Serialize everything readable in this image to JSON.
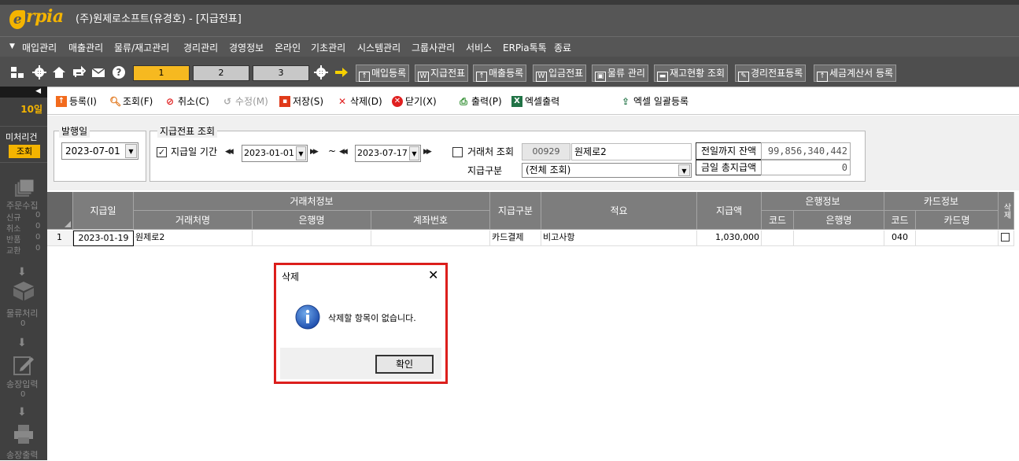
{
  "app": {
    "logo": "rpia",
    "logo_initial": "e",
    "title": "(주)원제로소프트(유경호) - [지급전표]"
  },
  "menu": [
    "매입관리",
    "매출관리",
    "물류/재고관리",
    "경리관리",
    "경영정보",
    "온라인",
    "기초관리",
    "시스템관리",
    "그룹사관리",
    "서비스",
    "ERPia톡톡",
    "종료"
  ],
  "tabs": [
    "1",
    "2",
    "3"
  ],
  "quick_buttons": [
    "매입등록",
    "지급전표",
    "매출등록",
    "입금전표",
    "물류 관리",
    "재고현황 조회",
    "경리전표등록",
    "세금계산서 등록"
  ],
  "left_panel": {
    "day_label": "10일",
    "unprocessed": "미처리건",
    "lookup": "조회",
    "order_collect": "주문수집",
    "new": "신규",
    "new_count": "0",
    "cancel": "취소",
    "cancel_count": "0",
    "return": "반품",
    "return_count": "0",
    "exchange": "교환",
    "exchange_count": "0",
    "logistics": "물류처리",
    "logistics_count": "0",
    "invoice_input": "송장입력",
    "invoice_input_count": "0",
    "invoice_print": "송장출력"
  },
  "actions": {
    "register": "등록(I)",
    "lookup": "조회(F)",
    "cancel": "취소(C)",
    "edit": "수정(M)",
    "save": "저장(S)",
    "delete": "삭제(D)",
    "close": "닫기(X)",
    "print": "출력(P)",
    "excel": "엑셀출력",
    "excel_bulk": "엑셀 일괄등록"
  },
  "search": {
    "issue_date_label": "발행일",
    "issue_date": "2023-07-01",
    "voucher_lookup_label": "지급전표 조회",
    "period_label": "지급일 기간",
    "period_checked": true,
    "date_from": "2023-01-01",
    "date_to": "2023-07-17",
    "tilde": "~",
    "partner_label": "거래처 조회",
    "partner_code": "00929",
    "partner_name": "원제로2",
    "pay_type_label": "지급구분",
    "pay_type": "(전체 조회)",
    "prev_balance_label": "전일까지 잔액",
    "prev_balance": "99,856,340,442",
    "today_total_label": "금일 총지급액",
    "today_total": "0"
  },
  "grid": {
    "headers": {
      "date": "지급일",
      "partner_info": "거래처정보",
      "partner_name": "거래처명",
      "bank_name": "은행명",
      "account_no": "계좌번호",
      "pay_type": "지급구분",
      "memo": "적요",
      "amount": "지급액",
      "bank_info": "은행정보",
      "bank_code": "코드",
      "bank_name2": "은행명",
      "card_info": "카드정보",
      "card_code": "코드",
      "card_name": "카드명",
      "delete": "삭제"
    },
    "rows": [
      {
        "no": "1",
        "date": "2023-01-19",
        "partner": "원제로2",
        "bank": "",
        "account": "",
        "pay_type": "카드결제",
        "memo": "비고사항",
        "amount": "1,030,000",
        "bank_code": "",
        "bank_name": "",
        "card_code": "040",
        "card_name": ""
      }
    ]
  },
  "dialog": {
    "title": "삭제",
    "message": "삭제할 항목이 없습니다.",
    "ok": "확인"
  },
  "colors": {
    "accent": "#f4b400",
    "dialog_border": "#e0201c",
    "header_gray": "#7d7d7d"
  }
}
